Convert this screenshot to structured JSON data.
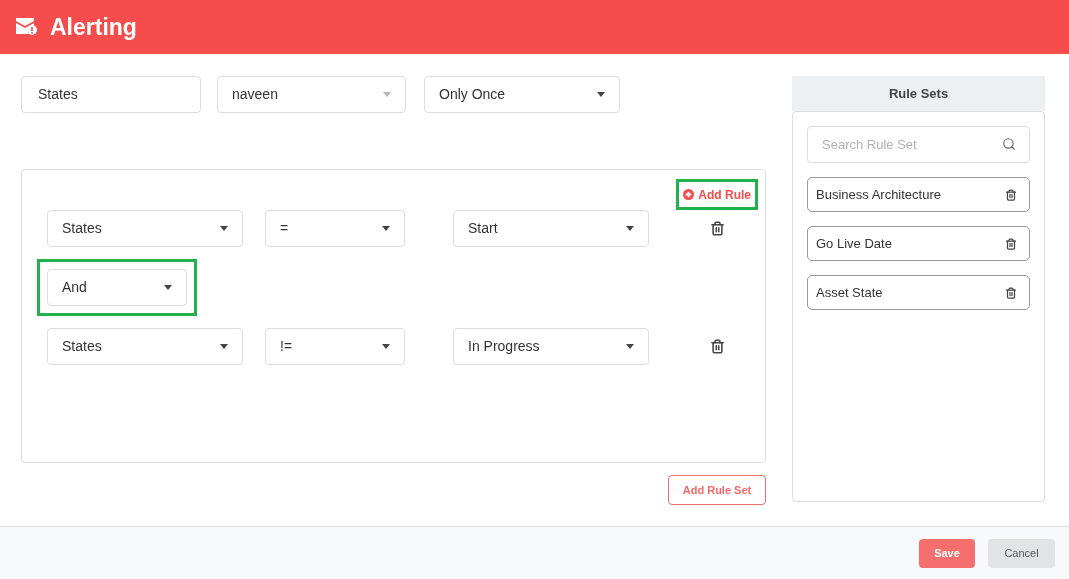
{
  "header": {
    "title": "Alerting"
  },
  "top_fields": [
    {
      "kind": "input",
      "value": "States"
    },
    {
      "kind": "select",
      "value": "naveen",
      "disabled": true
    },
    {
      "kind": "select",
      "value": "Only Once",
      "disabled": false
    }
  ],
  "rule_box": {
    "add_rule": {
      "label": "Add Rule",
      "highlighted": true
    },
    "rows": [
      {
        "kind": "rule",
        "field": "States",
        "operator": "=",
        "value": "Start"
      },
      {
        "kind": "connector",
        "value": "And",
        "highlighted": true
      },
      {
        "kind": "rule",
        "field": "States",
        "operator": "!=",
        "value": "In Progress"
      }
    ]
  },
  "add_rule_set": "Add Rule Set",
  "rule_sets": {
    "title": "Rule Sets",
    "search_placeholder": "Search Rule Set",
    "items": [
      "Business Architecture",
      "Go Live Date",
      "Asset State"
    ]
  },
  "footer": {
    "save": "Save",
    "cancel": "Cancel"
  }
}
